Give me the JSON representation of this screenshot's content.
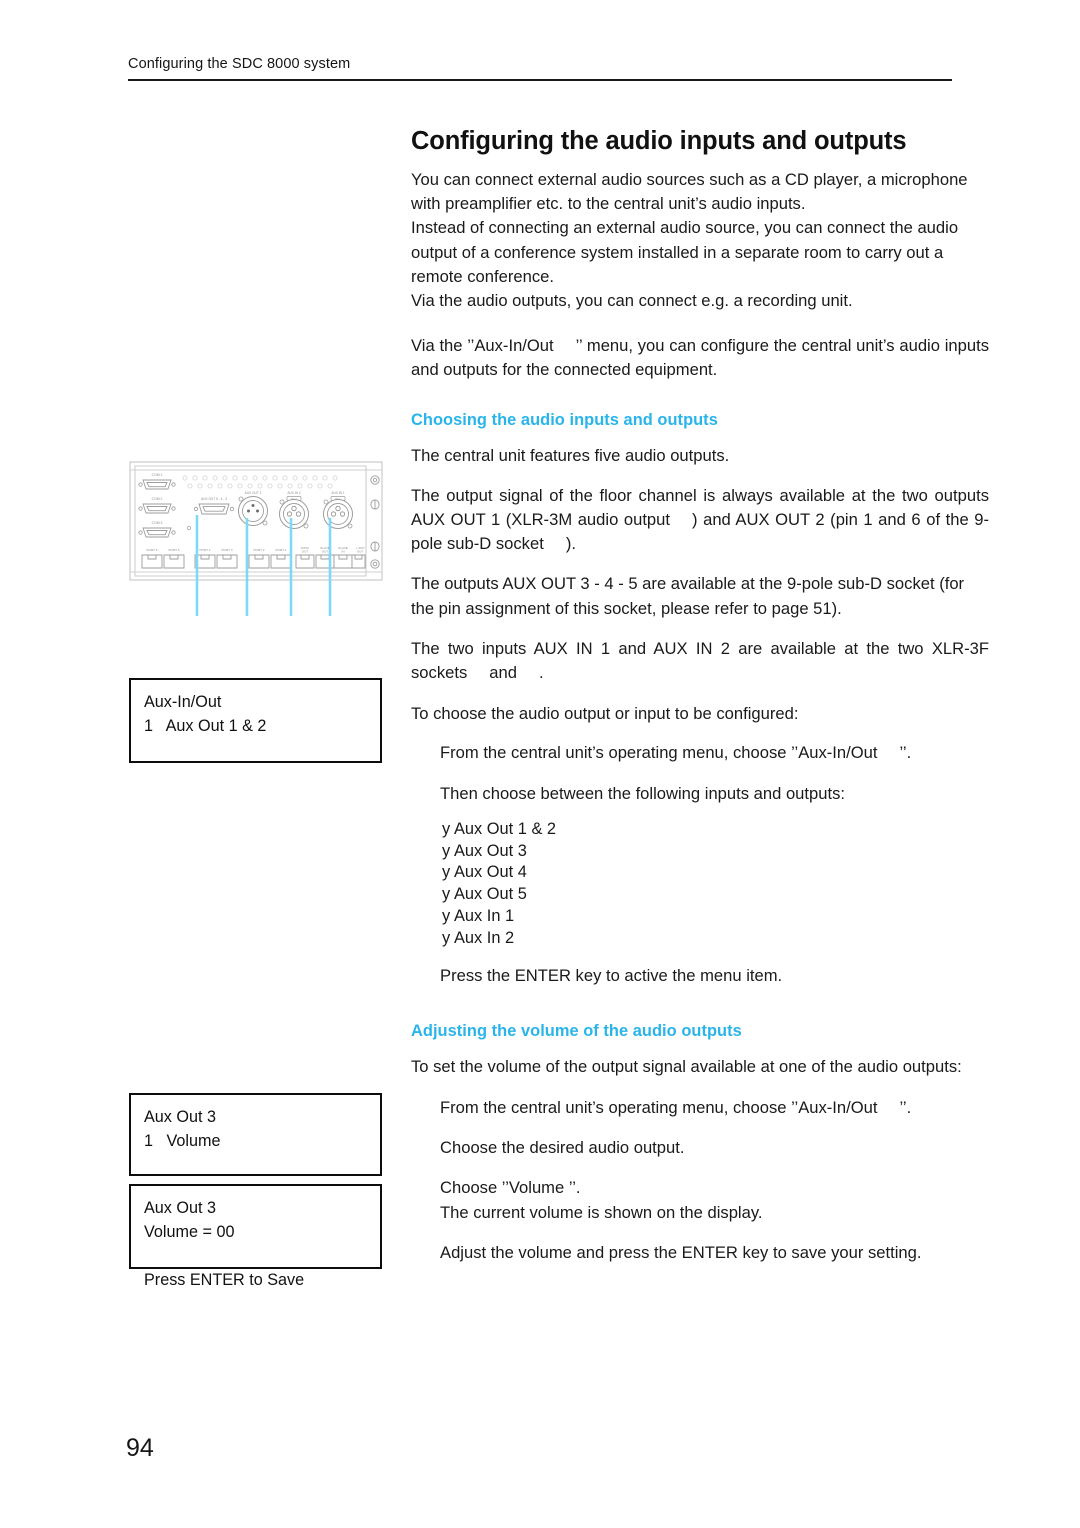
{
  "document": {
    "running_header": "Configuring the SDC 8000 system",
    "page_number": "94",
    "accent_color": "#29b4ea"
  },
  "title": "Configuring the audio inputs and outputs",
  "intro": {
    "p1_line1": "You can connect external audio sources such as a CD player, a microphone",
    "p1_line2": "with preamplifier etc. to the central unit’s audio inputs.",
    "p1_line3": "Instead of connecting an external audio source, you can connect the audio",
    "p1_line4": "output of a conference system installed in a separate room to carry out a",
    "p1_line5": "remote conference.",
    "p1_line6": "Via the audio outputs, you can connect e.g. a recording unit.",
    "p2_before": "Via the ’’Aux-In/Out",
    "p2_after": "’’ menu, you can configure the central unit’s audio inputs and outputs for the connected equipment."
  },
  "section_choosing": {
    "heading": "Choosing the audio inputs and outputs",
    "p1": "The central unit features five audio outputs.",
    "p2_a": "The output signal of the floor channel is always available at the two outputs AUX OUT 1 (XLR-3M audio output",
    "p2_b": ") and AUX OUT 2 (pin 1 and 6 of the 9-pole sub-D socket",
    "p2_c": ").",
    "p3": "The outputs AUX OUT 3 - 4 - 5 are available at the 9-pole sub-D socket (for the pin assignment of this socket, please refer to page 51).",
    "p4_a": "The two inputs AUX IN 1 and AUX IN 2 are available at the two XLR-3F sockets",
    "p4_b": "and",
    "p4_c": ".",
    "p5": "To choose the audio output or input to be configured:",
    "step1_a": "From the central unit’s operating menu, choose ’’Aux-In/Out",
    "step1_b": "’’.",
    "step2": "Then choose between the following inputs and outputs:",
    "bullet_glyph": "y",
    "options": [
      "Aux Out 1 & 2",
      "Aux Out 3",
      "Aux Out 4",
      "Aux Out 5",
      "Aux In 1",
      "Aux In 2"
    ],
    "step3": "Press the ENTER key to active the menu item."
  },
  "section_volume": {
    "heading": "Adjusting the volume of the audio outputs",
    "p1": "To set the volume of the output signal available at one of the audio outputs:",
    "step1_a": "From the central unit’s operating menu, choose ’’Aux-In/Out",
    "step1_b": "’’.",
    "step2": "Choose the desired audio output.",
    "step3_line1": "Choose ’’Volume ’’.",
    "step3_line2": "The current volume is shown on the display.",
    "step4": "Adjust the volume and press the ENTER key to save your setting."
  },
  "lcd_displays": [
    {
      "id": "aux-in-out",
      "line1": "Aux-In/Out",
      "line2": "1   Aux Out 1 & 2",
      "line3": "",
      "line4": ""
    },
    {
      "id": "aux-out-3-volume",
      "line1": "Aux Out 3",
      "line2": "1   Volume",
      "line3": "",
      "line4": ""
    },
    {
      "id": "aux-out-3-save",
      "line1": "Aux Out 3",
      "line2": "Volume = 00",
      "line3": "",
      "line4": "Press ENTER to Save"
    }
  ],
  "figure": {
    "caption_alt": "Rear panel of the central unit",
    "port_labels_row": [
      "PORT 6",
      "PORT 5",
      "PORT 4",
      "PORT 3",
      "PORT 2",
      "PORT 1",
      "DATA OUT",
      "SLAVE OUT",
      "SLAVE IN",
      "+ 3CH OUT"
    ],
    "connector_labels": [
      "COM 1",
      "COM 2",
      "COM 3",
      "AUX OUT 5 - 4 - 3",
      "AUX OUT 1",
      "AUX IN 2",
      "AUX IN 1"
    ],
    "leader_color": "#7ed9f7",
    "leader_count": 4
  }
}
